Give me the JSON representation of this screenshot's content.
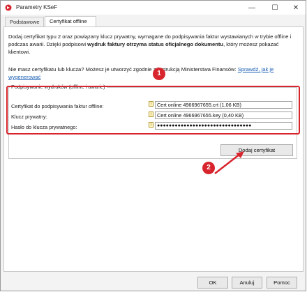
{
  "window": {
    "title": "Parametry KSeF"
  },
  "tabs": [
    {
      "label": "Podstawowe",
      "active": false
    },
    {
      "label": "Certyfikat offline",
      "active": true
    }
  ],
  "intro": {
    "part1": "Dodaj certyfikat typu 2 oraz powiązany klucz prywatny, wymagane do podpisywania faktur wystawianych w trybie offline i podczas awarii. Dzięki podpisowi ",
    "bold": "wydruk faktury otrzyma status oficjalnego dokumentu",
    "part2": ", który możesz pokazać klientowi."
  },
  "help": {
    "text": "Nie masz certyfikatu lub klucza? Możesz je utworzyć zgodnie z instrukcją Ministerstwa Finansów: ",
    "link": "Sprawdź, jak je wygenerować"
  },
  "signing_group": {
    "legend": "Podpisywanie wydruków (offline i awarie)",
    "fields": [
      {
        "label": "Certyfikat do podpisywania faktur offline:",
        "value": "Cert online 4966967655.crt (1,06 KB)"
      },
      {
        "label": "Klucz prywatny:",
        "value": "Cert online 4966967655.key (0,40 KB)"
      },
      {
        "label": "Hasło do klucza prywatnego:",
        "value": "●●●●●●●●●●●●●●●●●●●●●●●●●●●●●●●●"
      }
    ],
    "warn_glyph": "!"
  },
  "add_button": "Dodaj certyfikat",
  "badges": {
    "one": "1",
    "two": "2"
  },
  "footer": {
    "ok": "OK",
    "cancel": "Anuluj",
    "help": "Pomoc"
  },
  "icons": {
    "minimize": "—",
    "maximize": "☐",
    "close": "✕"
  },
  "colors": {
    "accent_red": "#d8252d",
    "link_blue": "#1a5fb4"
  }
}
